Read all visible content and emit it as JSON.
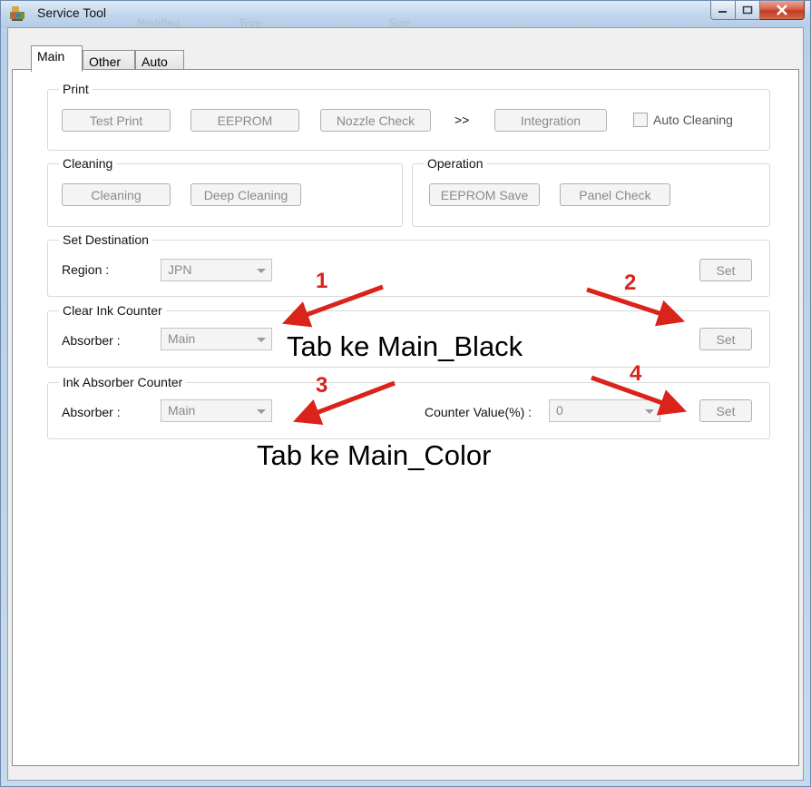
{
  "window": {
    "title": "Service Tool",
    "ghost_columns": [
      "Modified",
      "Type",
      "Size"
    ]
  },
  "tabs": [
    {
      "label": "Main",
      "active": true
    },
    {
      "label": "Other",
      "active": false
    },
    {
      "label": "Auto",
      "active": false
    }
  ],
  "print": {
    "title": "Print",
    "test_print": "Test Print",
    "eeprom": "EEPROM",
    "nozzle_check": "Nozzle Check",
    "chevron": ">>",
    "integration": "Integration",
    "auto_cleaning": "Auto Cleaning"
  },
  "cleaning": {
    "title": "Cleaning",
    "cleaning": "Cleaning",
    "deep_cleaning": "Deep Cleaning"
  },
  "operation": {
    "title": "Operation",
    "eeprom_save": "EEPROM Save",
    "panel_check": "Panel Check"
  },
  "set_destination": {
    "title": "Set Destination",
    "region_label": "Region :",
    "region_value": "JPN",
    "set": "Set"
  },
  "clear_ink_counter": {
    "title": "Clear Ink Counter",
    "absorber_label": "Absorber :",
    "absorber_value": "Main",
    "set": "Set"
  },
  "ink_absorber_counter": {
    "title": "Ink Absorber Counter",
    "absorber_label": "Absorber :",
    "absorber_value": "Main",
    "counter_label": "Counter Value(%) :",
    "counter_value": "0",
    "set": "Set"
  },
  "annotations": {
    "num1": "1",
    "num2": "2",
    "num3": "3",
    "num4": "4",
    "note_black": "Tab ke Main_Black",
    "note_color": "Tab ke Main_Color",
    "arrow_color": "#d9231b"
  }
}
